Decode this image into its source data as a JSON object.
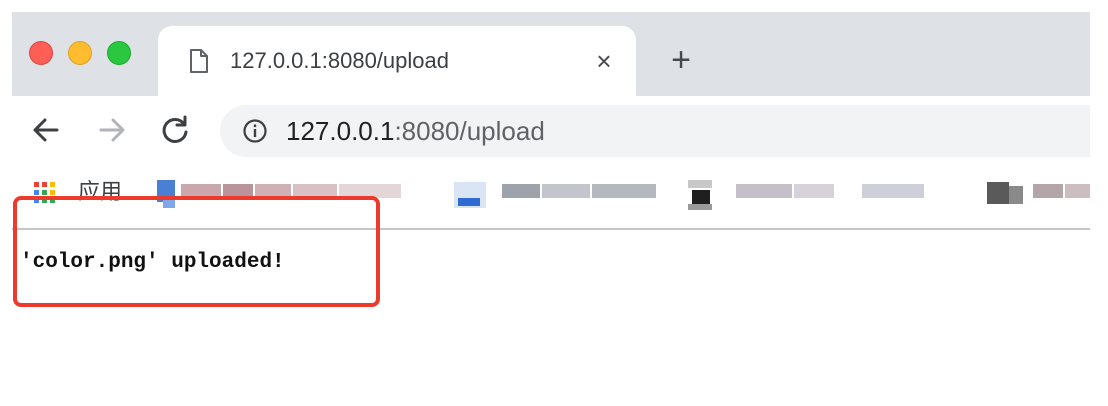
{
  "tab": {
    "title": "127.0.0.1:8080/upload",
    "favicon": "page-icon",
    "close_glyph": "×",
    "new_tab_glyph": "+"
  },
  "window_controls": {
    "close_color": "#fd5f57",
    "minimize_color": "#febc2e",
    "maximize_color": "#29c840"
  },
  "toolbar": {
    "back_icon": "back-arrow-icon",
    "forward_icon": "forward-arrow-icon",
    "reload_icon": "reload-icon",
    "site_info_icon": "info-icon",
    "url_host": "127.0.0.1",
    "url_rest": ":8080/upload"
  },
  "bookmarks": {
    "apps_label": "应用",
    "apps_icon": "apps-grid-icon"
  },
  "page": {
    "message": "'color.png' uploaded!"
  },
  "annotation": {
    "highlight_color": "#ec3a2c"
  }
}
